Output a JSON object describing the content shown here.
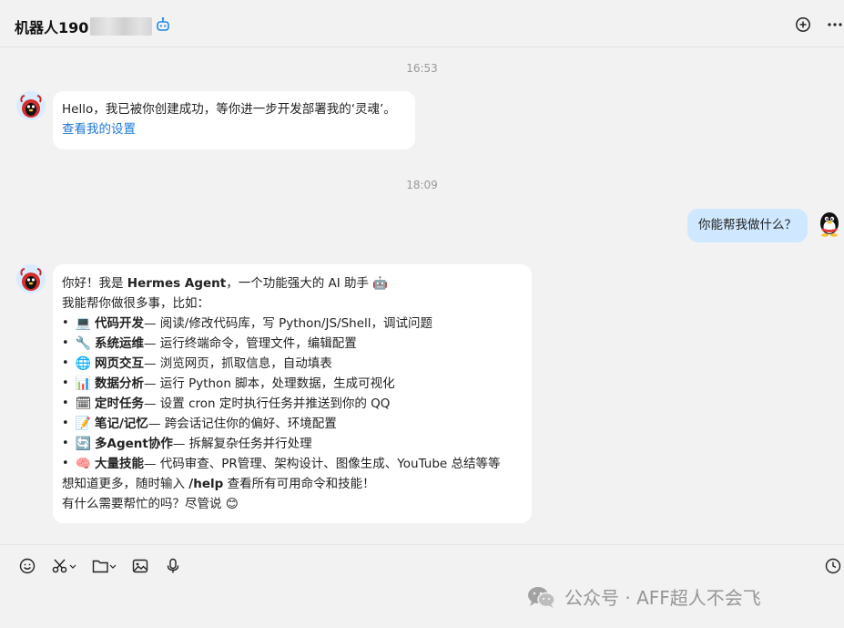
{
  "header": {
    "title": "机器人190",
    "icons": [
      "bot-icon",
      "add-circle-icon",
      "more-icon"
    ]
  },
  "messages": {
    "time1": "16:53",
    "msg1": {
      "line1": "Hello，我已被你创建成功，等你进一步开发部署我的‘灵魂’。",
      "link": "查看我的设置"
    },
    "time2": "18:09",
    "user_msg": "你能帮我做什么？",
    "msg2": {
      "intro_pre": "你好！我是 ",
      "intro_name": "Hermes Agent",
      "intro_post": "，一个功能强大的 AI 助手 🤖",
      "line2": "我能帮你做很多事，比如：",
      "items": [
        {
          "emoji": "💻",
          "title": "代码开发",
          "desc": " — 阅读/修改代码库，写 Python/JS/Shell，调试问题"
        },
        {
          "emoji": "🔧",
          "title": "系统运维",
          "desc": " — 运行终端命令，管理文件，编辑配置"
        },
        {
          "emoji": "🌐",
          "title": "网页交互",
          "desc": " — 浏览网页，抓取信息，自动填表"
        },
        {
          "emoji": "📊",
          "title": "数据分析",
          "desc": " — 运行 Python 脚本，处理数据，生成可视化"
        },
        {
          "emoji": "🗓",
          "title": "定时任务",
          "desc": " — 设置 cron 定时执行任务并推送到你的 QQ"
        },
        {
          "emoji": "📝",
          "title": "笔记/记忆",
          "desc": " — 跨会话记住你的偏好、环境配置"
        },
        {
          "emoji": "🔄",
          "title": "多Agent协作",
          "desc": " — 拆解复杂任务并行处理"
        },
        {
          "emoji": "🧠",
          "title": "大量技能",
          "desc": " — 代码审查、PR管理、架构设计、图像生成、YouTube 总结等等"
        }
      ],
      "outro_pre": "想知道更多，随时输入 ",
      "outro_cmd": "/help",
      "outro_post": " 查看所有可用命令和技能！",
      "last": "有什么需要帮忙的吗？尽管说 😊"
    }
  },
  "toolbar": {
    "icons": [
      "emoji-icon",
      "scissors-icon",
      "folder-icon",
      "image-icon",
      "microphone-icon",
      "clock-icon"
    ]
  },
  "watermark": {
    "text": "公众号 · AFF超人不会飞"
  }
}
